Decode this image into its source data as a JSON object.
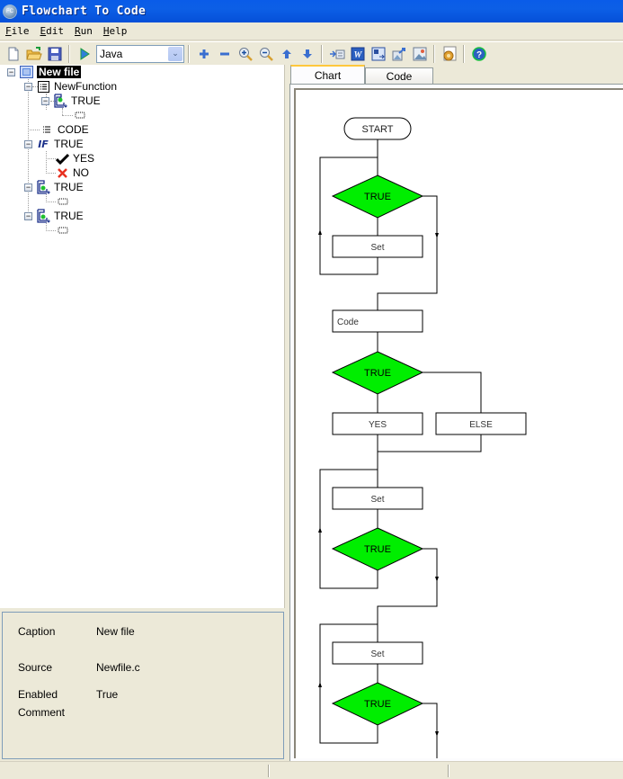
{
  "window": {
    "title": "Flowchart To Code",
    "app_icon_text": "FC"
  },
  "menu": {
    "items": [
      "File",
      "Edit",
      "Run",
      "Help"
    ]
  },
  "toolbar": {
    "language": {
      "selected": "Java"
    },
    "buttons": [
      "new-file",
      "open-file",
      "save",
      "run",
      "add",
      "remove",
      "zoom-in",
      "zoom-out",
      "move-up",
      "move-down",
      "insert",
      "export-word",
      "export-flow",
      "export-image",
      "picture",
      "settings",
      "help"
    ]
  },
  "tree": {
    "nodes": [
      {
        "label": "New file",
        "icon": "file-icon",
        "selected": true,
        "expanded": true
      },
      {
        "label": "NewFunction",
        "icon": "function-icon",
        "expanded": true
      },
      {
        "label": "TRUE",
        "icon": "loop-icon",
        "expanded": true
      },
      {
        "label": "",
        "icon": "empty-node-icon"
      },
      {
        "label": "CODE",
        "icon": "code-icon"
      },
      {
        "label": "TRUE",
        "icon": "if-icon",
        "expanded": true
      },
      {
        "label": "YES",
        "icon": "check-icon"
      },
      {
        "label": "NO",
        "icon": "cross-icon"
      },
      {
        "label": "TRUE",
        "icon": "loop-icon",
        "expanded": true
      },
      {
        "label": "",
        "icon": "empty-node-icon"
      },
      {
        "label": "TRUE",
        "icon": "loop-icon",
        "expanded": true
      },
      {
        "label": "",
        "icon": "empty-node-icon"
      }
    ],
    "if_icon_text": "IF"
  },
  "properties": {
    "rows": [
      {
        "label": "Caption",
        "value": "New file"
      },
      {
        "label": "Source",
        "value": "Newfile.c"
      },
      {
        "label": "Enabled",
        "value": "True"
      },
      {
        "label": "Comment",
        "value": ""
      }
    ]
  },
  "tabs": {
    "chart": "Chart",
    "code": "Code",
    "active": "Chart"
  },
  "flowchart": {
    "decision_color": "#00ee00",
    "nodes": {
      "start": "START",
      "loop1_cond": "TRUE",
      "loop1_body": "Set",
      "code": "Code",
      "if_cond": "TRUE",
      "if_yes": "YES",
      "if_else": "ELSE",
      "loop2_body": "Set",
      "loop2_cond": "TRUE",
      "loop3_body": "Set",
      "loop3_cond": "TRUE"
    }
  }
}
